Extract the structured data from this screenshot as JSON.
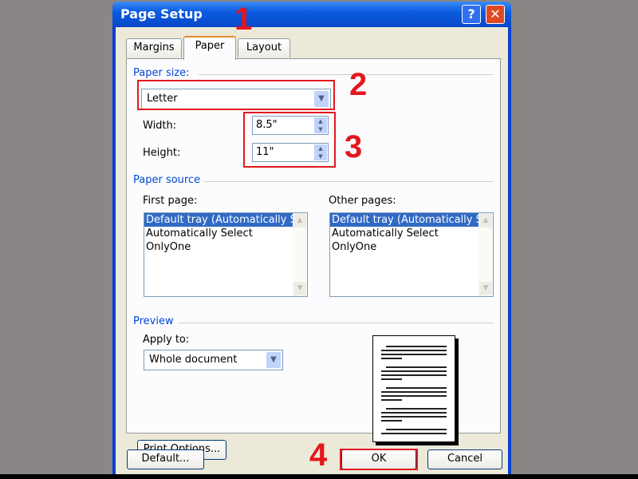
{
  "window": {
    "title": "Page Setup",
    "help_icon": "?",
    "close_icon": "✕"
  },
  "tabs": [
    {
      "label": "Margins"
    },
    {
      "label": "Paper",
      "active": true
    },
    {
      "label": "Layout"
    }
  ],
  "paper_size": {
    "group_label": "Paper size:",
    "selected": "Letter",
    "width_label": "Width:",
    "width_value": "8.5\"",
    "height_label": "Height:",
    "height_value": "11\""
  },
  "paper_source": {
    "group_label": "Paper source",
    "first_page": {
      "label": "First page:",
      "items": [
        "Default tray (Automatically Select)",
        "Automatically Select",
        "OnlyOne"
      ],
      "selected_index": 0
    },
    "other_pages": {
      "label": "Other pages:",
      "items": [
        "Default tray (Automatically Select)",
        "Automatically Select",
        "OnlyOne"
      ],
      "selected_index": 0
    }
  },
  "preview": {
    "group_label": "Preview",
    "apply_to_label": "Apply to:",
    "apply_to_value": "Whole document",
    "print_options": "Print Options..."
  },
  "buttons": {
    "default": "Default...",
    "ok": "OK",
    "cancel": "Cancel"
  },
  "annotations": [
    "1",
    "2",
    "3",
    "4"
  ],
  "colors": {
    "annotation": "#e3171e",
    "group_label": "#0046d5",
    "selection": "#316ac5"
  }
}
